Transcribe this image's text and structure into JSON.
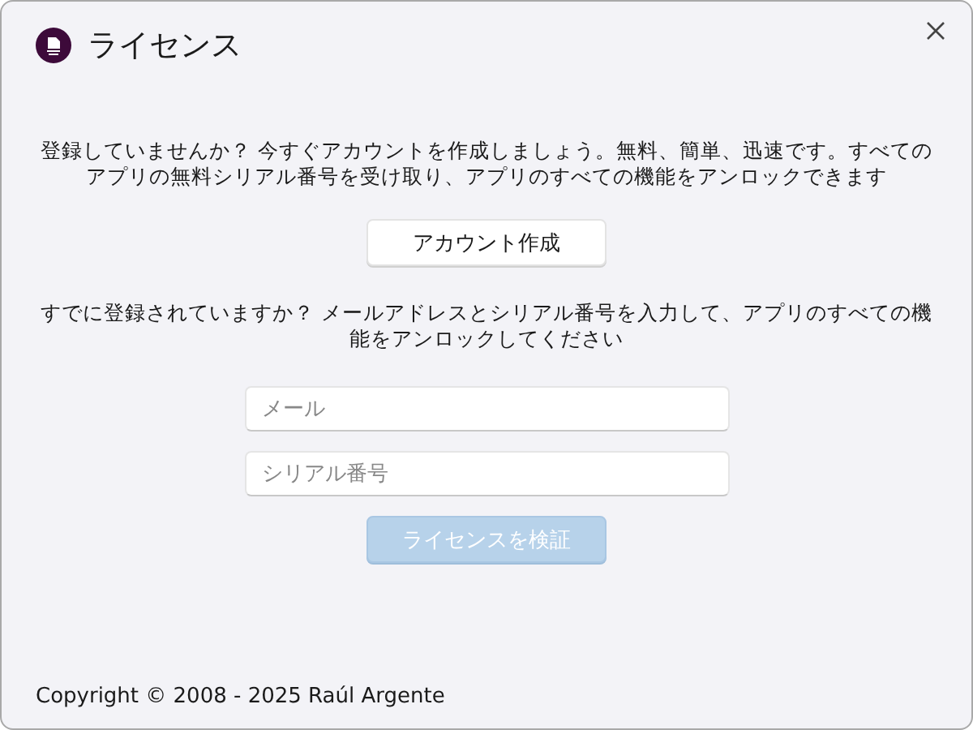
{
  "window": {
    "title": "ライセンス"
  },
  "register": {
    "text": "登録していませんか？ 今すぐアカウントを作成しましょう。無料、簡単、迅速です。すべてのアプリの無料シリアル番号を受け取り、アプリのすべての機能をアンロックできます",
    "button": "アカウント作成"
  },
  "activate": {
    "text": "すでに登録されていますか？ メールアドレスとシリアル番号を入力して、アプリのすべての機能をアンロックしてください",
    "email": {
      "placeholder": "メール"
    },
    "serial": {
      "placeholder": "シリアル番号"
    },
    "button": {
      "label": "ライセンスを検証",
      "disabled": true
    }
  },
  "footer": "Copyright © 2008 - 2025 Raúl Argente"
}
